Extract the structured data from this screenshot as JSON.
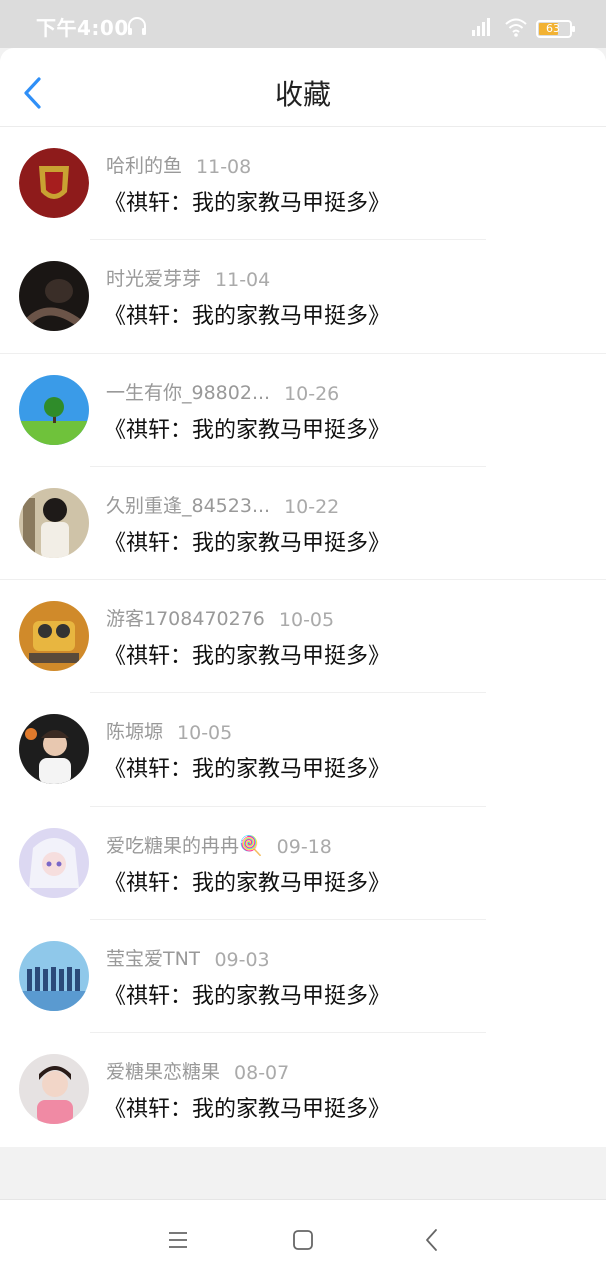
{
  "status_bar": {
    "time": "下午4:00",
    "battery": "63",
    "icons": [
      "headphone-icon",
      "signal-icon",
      "wifi-icon",
      "battery-icon"
    ]
  },
  "header": {
    "title": "收藏",
    "back_icon": "chevron-left-icon"
  },
  "colors": {
    "accent": "#2f8ff7",
    "status_bar_bg": "#dcdcdc",
    "username_text": "#999999",
    "title_text": "#111111"
  },
  "favorites": [
    {
      "user": "哈利的鱼",
      "date": "11-08",
      "book": "《祺轩：我的家教马甲挺多》"
    },
    {
      "user": "时光爱芽芽",
      "date": "11-04",
      "book": "《祺轩：我的家教马甲挺多》"
    },
    {
      "user": "一生有你_98802...",
      "date": "10-26",
      "book": "《祺轩：我的家教马甲挺多》"
    },
    {
      "user": "久别重逢_84523...",
      "date": "10-22",
      "book": "《祺轩：我的家教马甲挺多》"
    },
    {
      "user": "游客1708470276",
      "date": "10-05",
      "book": "《祺轩：我的家教马甲挺多》"
    },
    {
      "user": "陈塬塬",
      "date": "10-05",
      "book": "《祺轩：我的家教马甲挺多》"
    },
    {
      "user": "爱吃糖果的冉冉🍭",
      "date": "09-18",
      "book": "《祺轩：我的家教马甲挺多》"
    },
    {
      "user": "莹宝爱TNT",
      "date": "09-03",
      "book": "《祺轩：我的家教马甲挺多》"
    },
    {
      "user": "爱糖果恋糖果",
      "date": "08-07",
      "book": "《祺轩：我的家教马甲挺多》"
    }
  ],
  "nav": {
    "icons": [
      "menu-icon",
      "home-square-icon",
      "back-triangle-icon"
    ]
  }
}
